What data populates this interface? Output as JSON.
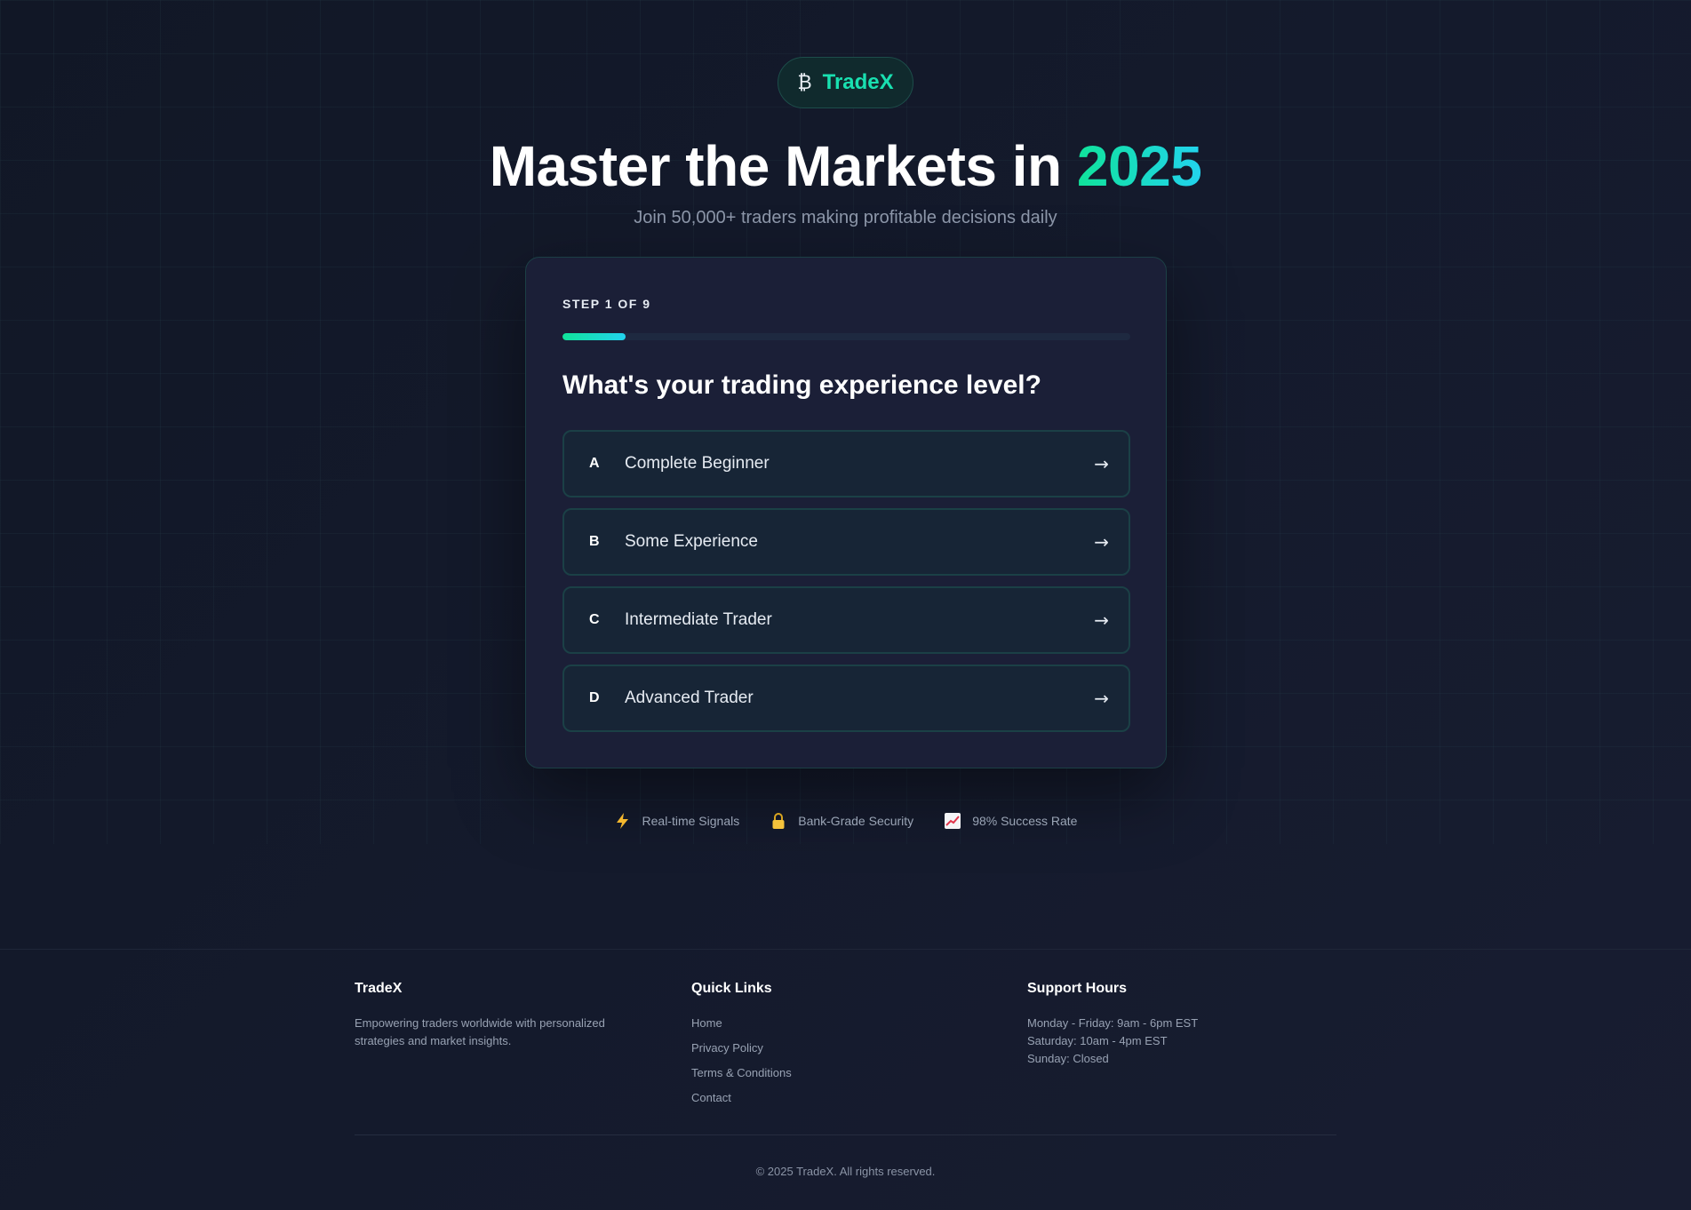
{
  "brand": {
    "icon": "bitcoin-icon",
    "symbol": "₿",
    "name": "TradeX"
  },
  "hero": {
    "headline_prefix": "Master the Markets in ",
    "headline_year": "2025",
    "subtitle": "Join 50,000+ traders making profitable decisions daily"
  },
  "quiz": {
    "step_label": "STEP 1 OF 9",
    "progress_fraction": 0.111,
    "question": "What's your trading experience level?",
    "options": [
      {
        "letter": "A",
        "label": "Complete Beginner",
        "arrow": "→"
      },
      {
        "letter": "B",
        "label": "Some Experience",
        "arrow": "→"
      },
      {
        "letter": "C",
        "label": "Intermediate Trader",
        "arrow": "→"
      },
      {
        "letter": "D",
        "label": "Advanced Trader",
        "arrow": "→"
      }
    ]
  },
  "features": [
    {
      "icon": "lightning-icon",
      "glyph": "⚡",
      "label": "Real-time Signals"
    },
    {
      "icon": "lock-icon",
      "glyph": "🔒",
      "label": "Bank-Grade Security"
    },
    {
      "icon": "chart-up-icon",
      "glyph": "📈",
      "label": "98% Success Rate"
    }
  ],
  "footer": {
    "about": {
      "title": "TradeX",
      "text": "Empowering traders worldwide with personalized strategies and market insights."
    },
    "links": {
      "title": "Quick Links",
      "items": [
        "Home",
        "Privacy Policy",
        "Terms & Conditions",
        "Contact"
      ]
    },
    "support": {
      "title": "Support Hours",
      "lines": [
        "Monday - Friday: 9am - 6pm EST",
        "Saturday: 10am - 4pm EST",
        "Sunday: Closed"
      ]
    },
    "copyright": "© 2025 TradeX. All rights reserved."
  },
  "colors": {
    "accent_green": "#10e39a",
    "accent_cyan": "#22d3ee",
    "background": "#131a2a",
    "card": "#1b1f37"
  }
}
